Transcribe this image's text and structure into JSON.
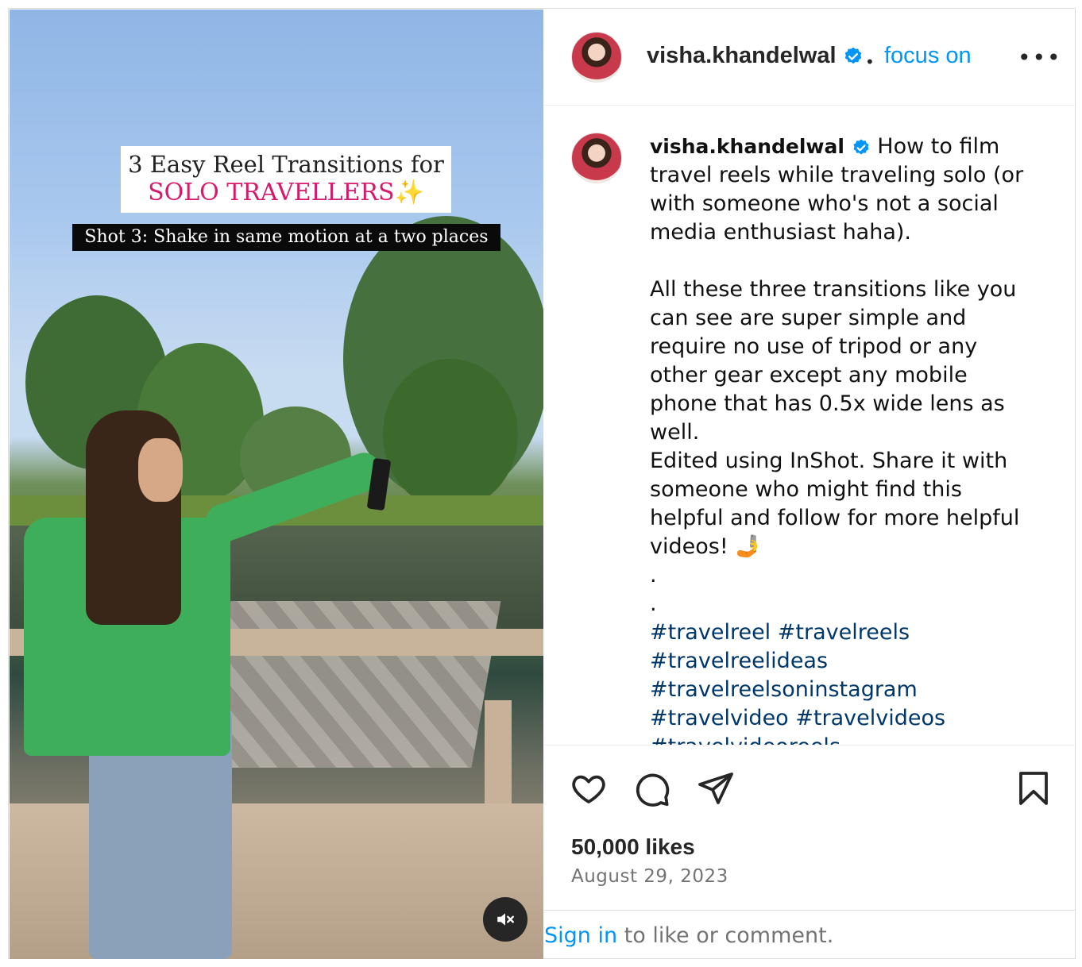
{
  "media": {
    "title_line1": "3 Easy Reel Transitions for",
    "title_line2": "SOLO TRAVELLERS",
    "title_sparkle": "✨",
    "subtitle": "Shot 3: Shake in same motion at a two places",
    "mute_icon": "muted-speaker-icon"
  },
  "header": {
    "username": "visha.khandelwal",
    "verified_icon": "verified-badge-icon",
    "separator": "•",
    "follow_label": "focus on",
    "more_icon": "more-options-icon",
    "more_label": "•••"
  },
  "caption": {
    "username": "visha.khandelwal",
    "p1": "How to film travel reels while traveling solo (or with someone who's not a social media enthusiast haha).",
    "p2": "All these three transitions like you can see are super simple and require no use of tripod or any other gear except any mobile phone that has 0.5x wide lens as well.",
    "p3": "Edited using InShot. Share it with someone who might find this helpful and follow for more helpful videos! 🤳",
    "dot1": ".",
    "dot2": ".",
    "hashtags_line1": "#travelreel #travelreels",
    "hashtags_line2": "#travelreelideas",
    "hashtags_line3": "#travelreelsoninstagram",
    "hashtags_line4": "#travelvideo #travelvideos",
    "hashtags_line5": "#travelvideoreels"
  },
  "actions": {
    "like_icon": "heart-icon",
    "comment_icon": "comment-icon",
    "share_icon": "send-icon",
    "save_icon": "bookmark-icon",
    "likes": "50,000 likes",
    "date": "August 29, 2023"
  },
  "footer": {
    "signin_link": "Sign in",
    "signin_rest": " to like or comment."
  },
  "colors": {
    "accent": "#0095f6",
    "hashtag": "#00376b",
    "title_pink": "#d6196b"
  }
}
